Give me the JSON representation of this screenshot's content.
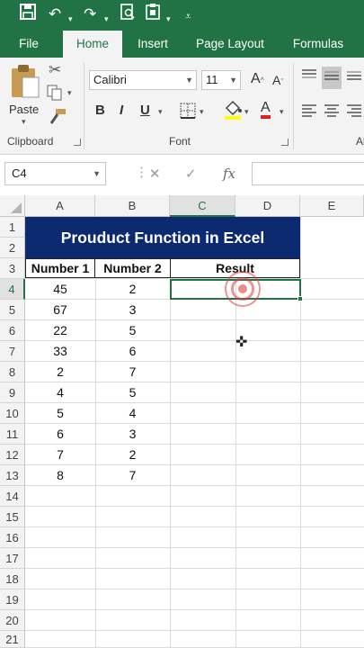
{
  "quick_access": {
    "icons": [
      "save-icon",
      "undo-icon",
      "redo-icon",
      "print-preview-icon",
      "clipboard-icon",
      "customize-icon"
    ]
  },
  "tabs": [
    {
      "label": "File",
      "active": false
    },
    {
      "label": "Home",
      "active": true
    },
    {
      "label": "Insert",
      "active": false
    },
    {
      "label": "Page Layout",
      "active": false
    },
    {
      "label": "Formulas",
      "active": false
    }
  ],
  "ribbon": {
    "clipboard": {
      "paste_label": "Paste",
      "group_label": "Clipboard"
    },
    "font": {
      "font_name": "Calibri",
      "font_size": "11",
      "bold": "B",
      "italic": "I",
      "underline": "U",
      "grow_font": "A",
      "shrink_font": "A",
      "font_color": "A",
      "group_label": "Font"
    },
    "alignment": {
      "group_label": "Al"
    }
  },
  "formula_bar": {
    "name_box": "C4",
    "cancel_glyph": "✕",
    "enter_glyph": "✓",
    "fx_label": "fx",
    "formula": ""
  },
  "sheet": {
    "columns": [
      "A",
      "B",
      "C",
      "D",
      "E"
    ],
    "selected_column": "C",
    "rows": [
      "1",
      "2",
      "3",
      "4",
      "5",
      "6",
      "7",
      "8",
      "9",
      "10",
      "11",
      "12",
      "13",
      "14",
      "15",
      "16",
      "17",
      "18",
      "19",
      "20",
      "21"
    ],
    "selected_row": "4",
    "title": "Prouduct Function in Excel",
    "headers": {
      "col_a": "Number 1",
      "col_b": "Number 2",
      "col_cd": "Result"
    },
    "data": [
      {
        "a": "45",
        "b": "2"
      },
      {
        "a": "67",
        "b": "3"
      },
      {
        "a": "22",
        "b": "5"
      },
      {
        "a": "33",
        "b": "6"
      },
      {
        "a": "2",
        "b": "7"
      },
      {
        "a": "4",
        "b": "5"
      },
      {
        "a": "5",
        "b": "4"
      },
      {
        "a": "6",
        "b": "3"
      },
      {
        "a": "7",
        "b": "2"
      },
      {
        "a": "8",
        "b": "7"
      }
    ],
    "active_cell": "C4"
  },
  "colors": {
    "excel_green": "#217346",
    "title_band": "#0b2a6f",
    "click_ring": "#dc3c3c"
  }
}
